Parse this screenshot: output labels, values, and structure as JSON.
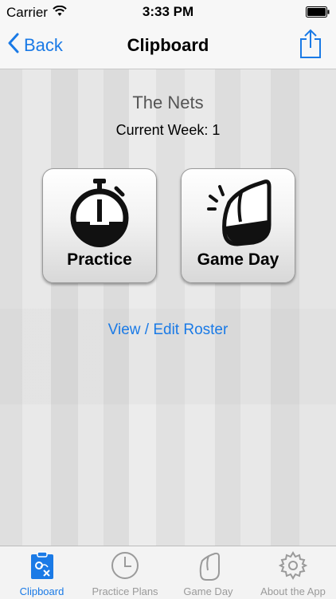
{
  "status_bar": {
    "carrier": "Carrier",
    "time": "3:33 PM"
  },
  "nav": {
    "back_label": "Back",
    "title": "Clipboard"
  },
  "main": {
    "team_name": "The Nets",
    "current_week": "Current Week: 1",
    "practice_label": "Practice",
    "gameday_label": "Game Day",
    "roster_link": "View / Edit Roster"
  },
  "tabs": [
    {
      "label": "Clipboard",
      "icon": "clipboard-icon",
      "active": true
    },
    {
      "label": "Practice Plans",
      "icon": "clock-icon",
      "active": false
    },
    {
      "label": "Game Day",
      "icon": "whistle-icon",
      "active": false
    },
    {
      "label": "About the App",
      "icon": "gear-icon",
      "active": false
    }
  ],
  "colors": {
    "accent": "#1a7ae6",
    "inactive": "#9a9a9a"
  }
}
